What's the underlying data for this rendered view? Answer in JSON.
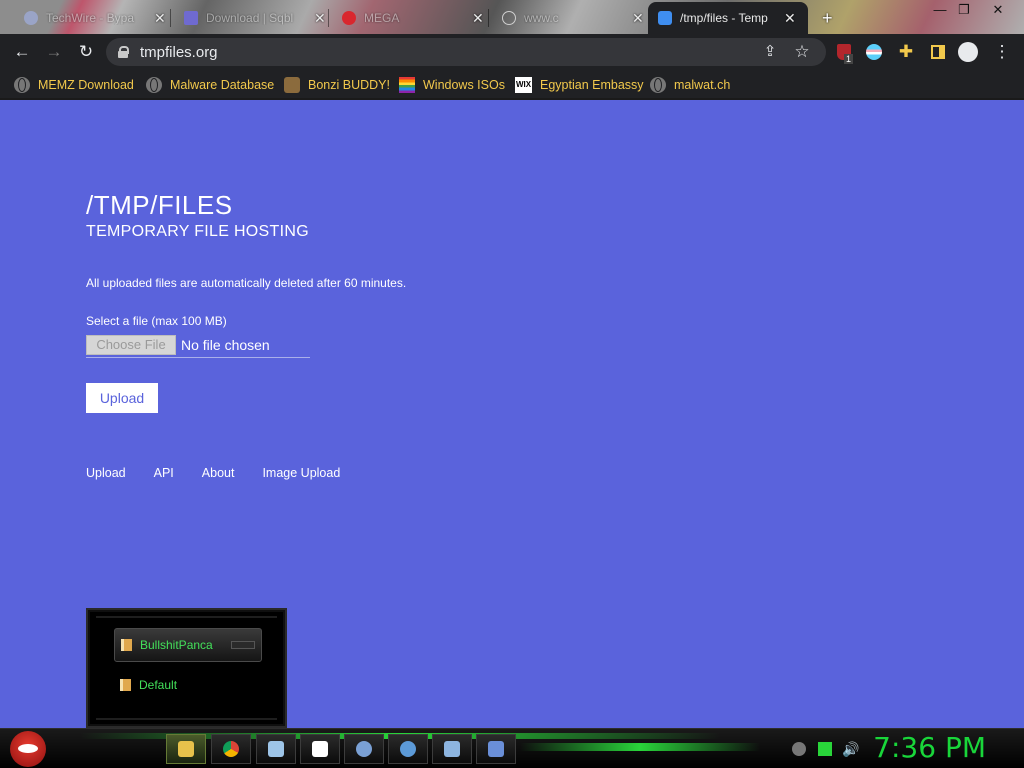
{
  "browser": {
    "tabs": [
      {
        "title": "TechWire - Bypa",
        "active": false
      },
      {
        "title": "Download | Sqbl",
        "active": false
      },
      {
        "title": "MEGA",
        "active": false
      },
      {
        "title": "www.c",
        "active": false
      },
      {
        "title": "/tmp/files - Temp",
        "active": true
      }
    ],
    "new_tab": "+",
    "url": "tmpfiles.org",
    "extension_badge": "1",
    "bookmarks": [
      {
        "label": "MEMZ Download"
      },
      {
        "label": "Malware Database"
      },
      {
        "label": "Bonzi BUDDY!"
      },
      {
        "label": "Windows ISOs"
      },
      {
        "label": "Egyptian Embassy"
      },
      {
        "label": "malwat.ch"
      }
    ],
    "bookmark_icons": {
      "wix": "WIX"
    }
  },
  "page": {
    "title": "/TMP/FILES",
    "subtitle": "TEMPORARY FILE HOSTING",
    "notice": "All uploaded files are automatically deleted after 60 minutes.",
    "file_label": "Select a file (max 100 MB)",
    "choose_button": "Choose File",
    "no_file": "No file chosen",
    "upload_button": "Upload",
    "footer_links": [
      "Upload",
      "API",
      "About",
      "Image Upload"
    ],
    "background_color": "#5a63dc"
  },
  "overlay_panel": {
    "items": [
      {
        "label": "BullshitPanca",
        "selected": true
      },
      {
        "label": "Default",
        "selected": false
      }
    ]
  },
  "taskbar": {
    "clock": "7:36 PM",
    "apps": [
      "explorer-icon",
      "chrome-icon",
      "notepad-icon",
      "7zip-icon",
      "magnifier-icon",
      "globe-icon",
      "window-icon",
      "hummingbird-icon"
    ]
  }
}
